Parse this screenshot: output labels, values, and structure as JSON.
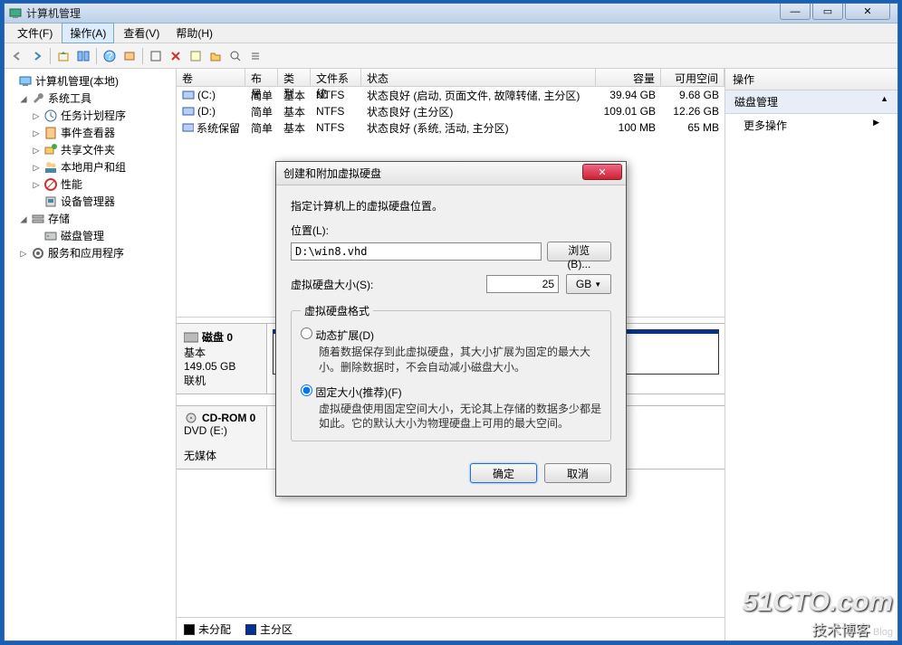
{
  "window": {
    "title": "计算机管理"
  },
  "winbtns": {
    "min": "—",
    "max": "▭",
    "close": "✕"
  },
  "menu": {
    "file": "文件(F)",
    "action": "操作(A)",
    "view": "查看(V)",
    "help": "帮助(H)"
  },
  "tree": [
    {
      "level": 0,
      "toggle": "",
      "icon": "computer",
      "label": "计算机管理(本地)"
    },
    {
      "level": 1,
      "toggle": "◢",
      "icon": "wrench",
      "label": "系统工具"
    },
    {
      "level": 2,
      "toggle": "▷",
      "icon": "clock",
      "label": "任务计划程序"
    },
    {
      "level": 2,
      "toggle": "▷",
      "icon": "eventlog",
      "label": "事件查看器"
    },
    {
      "level": 2,
      "toggle": "▷",
      "icon": "share",
      "label": "共享文件夹"
    },
    {
      "level": 2,
      "toggle": "▷",
      "icon": "users",
      "label": "本地用户和组"
    },
    {
      "level": 2,
      "toggle": "▷",
      "icon": "perf",
      "label": "性能"
    },
    {
      "level": 2,
      "toggle": "",
      "icon": "device",
      "label": "设备管理器"
    },
    {
      "level": 1,
      "toggle": "◢",
      "icon": "storage",
      "label": "存储"
    },
    {
      "level": 2,
      "toggle": "",
      "icon": "disk",
      "label": "磁盘管理"
    },
    {
      "level": 1,
      "toggle": "▷",
      "icon": "services",
      "label": "服务和应用程序"
    }
  ],
  "vol_header": {
    "vol": "卷",
    "layout": "布局",
    "type": "类型",
    "fs": "文件系统",
    "status": "状态",
    "cap": "容量",
    "free": "可用空间"
  },
  "volumes": [
    {
      "name": "(C:)",
      "icon": "drive",
      "layout": "简单",
      "type": "基本",
      "fs": "NTFS",
      "status": "状态良好 (启动, 页面文件, 故障转储, 主分区)",
      "cap": "39.94 GB",
      "free": "9.68 GB"
    },
    {
      "name": "(D:)",
      "icon": "drive",
      "layout": "简单",
      "type": "基本",
      "fs": "NTFS",
      "status": "状态良好 (主分区)",
      "cap": "109.01 GB",
      "free": "12.26 GB"
    },
    {
      "name": "系统保留",
      "icon": "drive",
      "layout": "简单",
      "type": "基本",
      "fs": "NTFS",
      "status": "状态良好 (系统, 活动, 主分区)",
      "cap": "100 MB",
      "free": "65 MB"
    }
  ],
  "disk0": {
    "title": "磁盘 0",
    "type": "基本",
    "size": "149.05 GB",
    "state": "联机"
  },
  "cdrom": {
    "title": "CD-ROM 0",
    "sub": "DVD (E:)",
    "state": "无媒体"
  },
  "legend": {
    "unalloc": "未分配",
    "primary": "主分区"
  },
  "actions": {
    "header": "操作",
    "section": "磁盘管理",
    "more": "更多操作",
    "arrow_up": "▲",
    "arrow_right": "▶"
  },
  "dialog": {
    "title": "创建和附加虚拟硬盘",
    "instruction": "指定计算机上的虚拟硬盘位置。",
    "location_label": "位置(L):",
    "location_value": "D:\\win8.vhd",
    "browse": "浏览(B)...",
    "size_label": "虚拟硬盘大小(S):",
    "size_value": "25",
    "size_unit": "GB",
    "format_legend": "虚拟硬盘格式",
    "dynamic_label": "动态扩展(D)",
    "dynamic_desc": "随着数据保存到此虚拟硬盘，其大小扩展为固定的最大大小。删除数据时，不会自动减小磁盘大小。",
    "fixed_label": "固定大小(推荐)(F)",
    "fixed_desc": "虚拟硬盘使用固定空间大小，无论其上存储的数据多少都是如此。它的默认大小为物理硬盘上可用的最大空间。",
    "ok": "确定",
    "cancel": "取消"
  },
  "watermark": {
    "big": "51CTO.com",
    "sub": "技术博客",
    "tag": "Blog"
  }
}
